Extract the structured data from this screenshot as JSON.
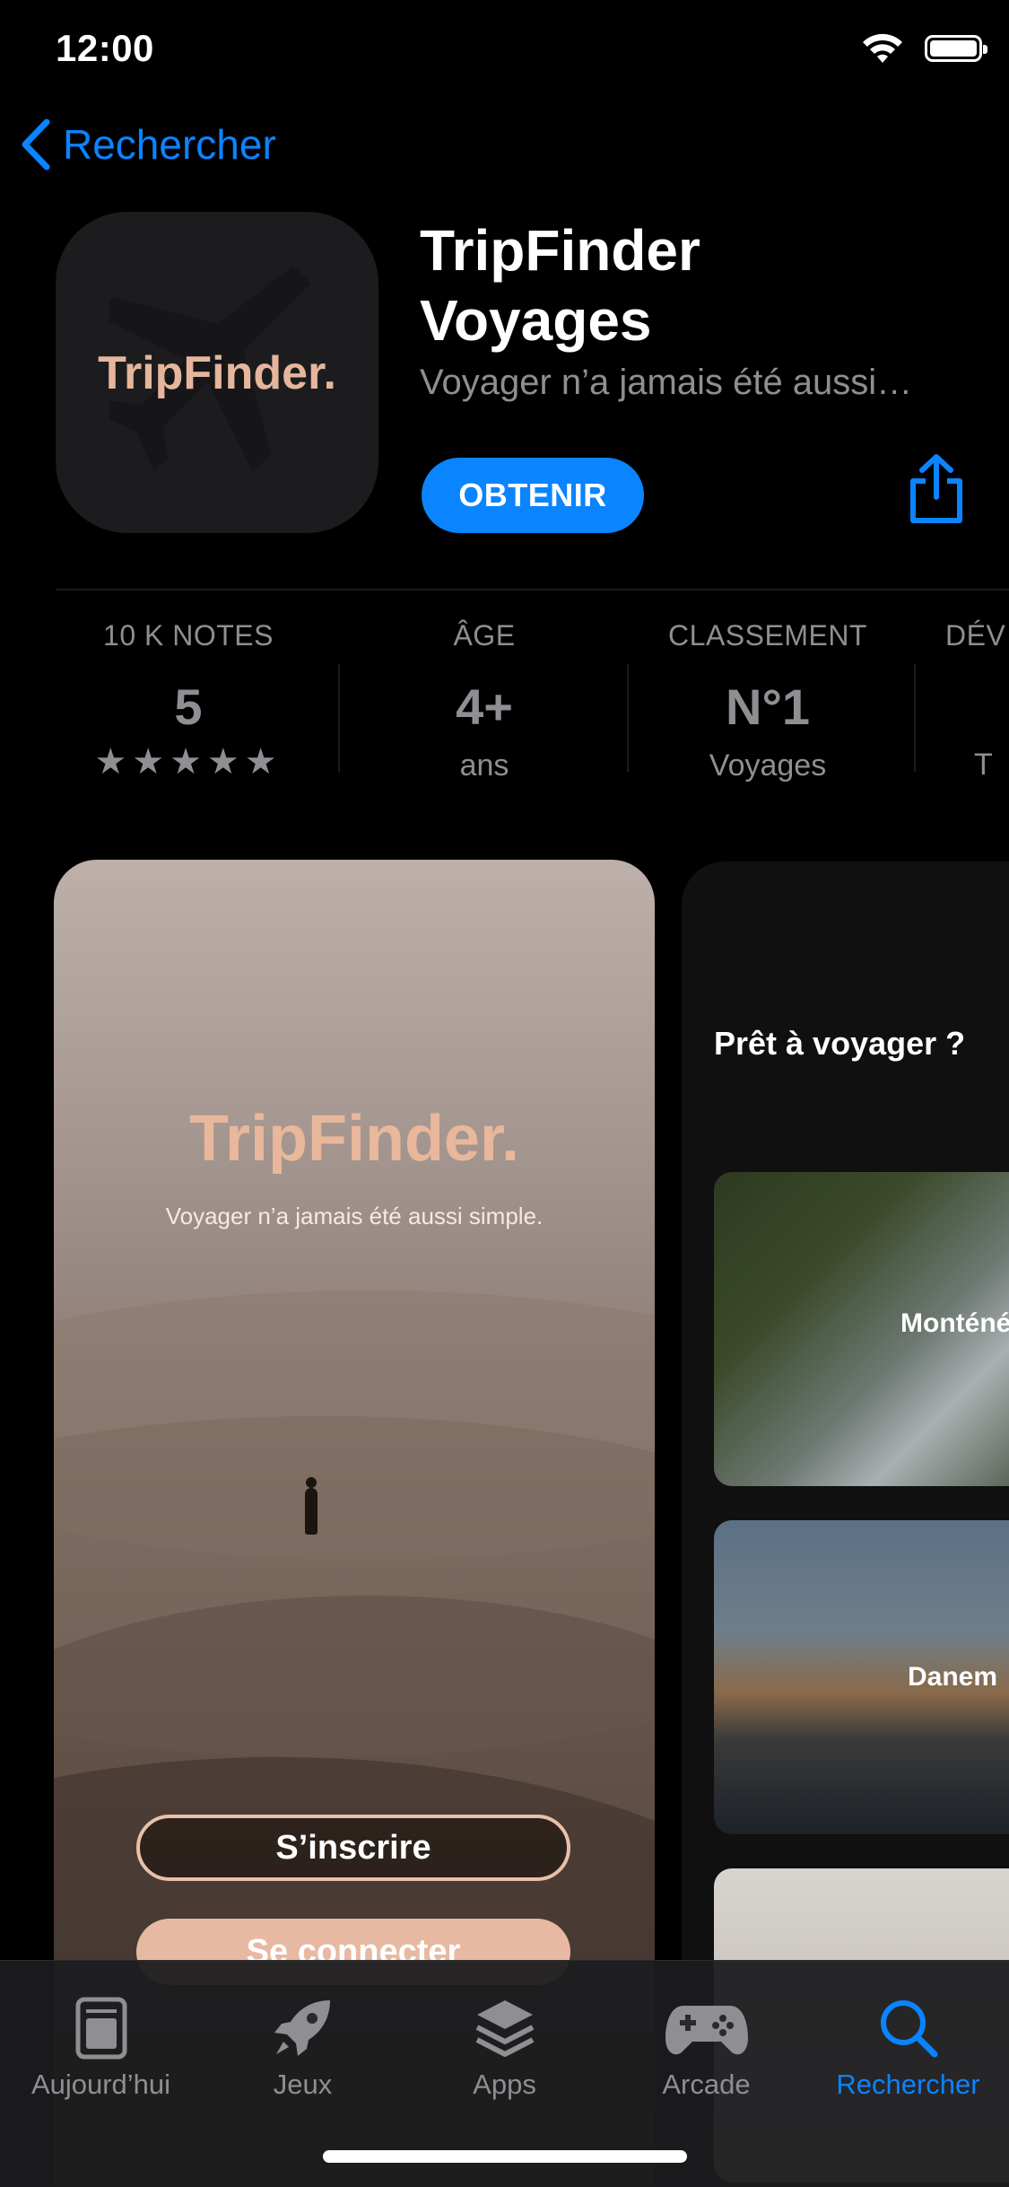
{
  "status_bar": {
    "time": "12:00"
  },
  "nav": {
    "back_label": "Rechercher"
  },
  "app": {
    "icon_text": "TripFinder.",
    "title_line1": "TripFinder",
    "title_line2": "Voyages",
    "subtitle": "Voyager n’a jamais été aussi…",
    "get_label": "OBTENIR"
  },
  "info": [
    {
      "label": "10 K NOTES",
      "value": "5",
      "sub": "★★★★★"
    },
    {
      "label": "ÂGE",
      "value": "4+",
      "sub": "ans"
    },
    {
      "label": "CLASSEMENT",
      "value": "N°1",
      "sub": "Voyages"
    },
    {
      "label": "DÉV",
      "value": "",
      "sub": "T"
    }
  ],
  "screenshot1": {
    "title": "TripFinder.",
    "tagline": "Voyager n’a jamais été aussi simple.",
    "signup_label": "S’inscrire",
    "login_label": "Se connecter"
  },
  "screenshot2": {
    "heading": "Prêt à voyager ?",
    "cards": [
      {
        "label": "Monténé"
      },
      {
        "label": "Danem"
      }
    ]
  },
  "tabbar": {
    "items": [
      {
        "label": "Aujourd’hui",
        "icon": "today-icon"
      },
      {
        "label": "Jeux",
        "icon": "rocket-icon"
      },
      {
        "label": "Apps",
        "icon": "layers-icon"
      },
      {
        "label": "Arcade",
        "icon": "gamepad-icon"
      },
      {
        "label": "Rechercher",
        "icon": "search-icon"
      }
    ],
    "active_color": "#0a84ff",
    "inactive_color": "#8e8e93"
  },
  "colors": {
    "accent": "#0a84ff",
    "brand": "#e9b79b",
    "background": "#000000"
  }
}
